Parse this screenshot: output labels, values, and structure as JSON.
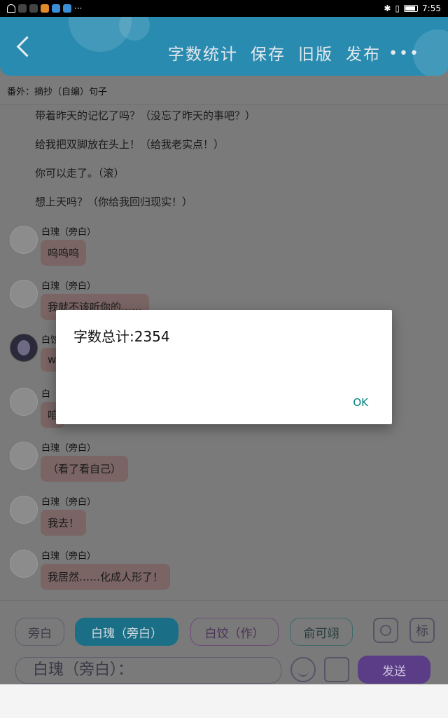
{
  "status_bar": {
    "time": "7:55",
    "icons": [
      "wifi-icon",
      "app-icons",
      "more-dots-icon",
      "bluetooth-icon",
      "vibrate-icon",
      "battery-icon"
    ]
  },
  "app_bar": {
    "back_icon": "back-arrow-icon",
    "actions": [
      "字数统计",
      "保存",
      "旧版",
      "发布"
    ],
    "more_label": "•••"
  },
  "subtitle": "番外：摘抄（自编）句子",
  "lines": [
    "带着昨天的记忆了吗？（没忘了昨天的事吧？）",
    "给我把双脚放在头上！（给我老实点！）",
    "你可以走了。（滚）",
    "想上天吗？（你给我回归现实！）"
  ],
  "messages": [
    {
      "sender": "白瑰（旁白）",
      "text": "呜呜呜"
    },
    {
      "sender": "白瑰（旁白）",
      "text": "我就不该听你的……"
    },
    {
      "sender": "白饺",
      "text": "w"
    },
    {
      "sender": "白",
      "text": "咱"
    },
    {
      "sender": "白瑰（旁白）",
      "text": "（看了看自己）"
    },
    {
      "sender": "白瑰（旁白）",
      "text": "我去！"
    },
    {
      "sender": "白瑰（旁白）",
      "text": "我居然……化成人形了！"
    }
  ],
  "roles": [
    "旁白",
    "白瑰（旁白）",
    "白饺（作）",
    "俞可翊"
  ],
  "tools": {
    "mark_label": "标",
    "send_label": "发送"
  },
  "input": {
    "value": "白瑰（旁白）："
  },
  "dialog": {
    "message": "字数总计:2354",
    "ok_label": "OK"
  },
  "colors": {
    "header": "#2a8bb0",
    "selected_role": "#1a6f86",
    "send": "#5a3d86",
    "ok": "#008080"
  }
}
